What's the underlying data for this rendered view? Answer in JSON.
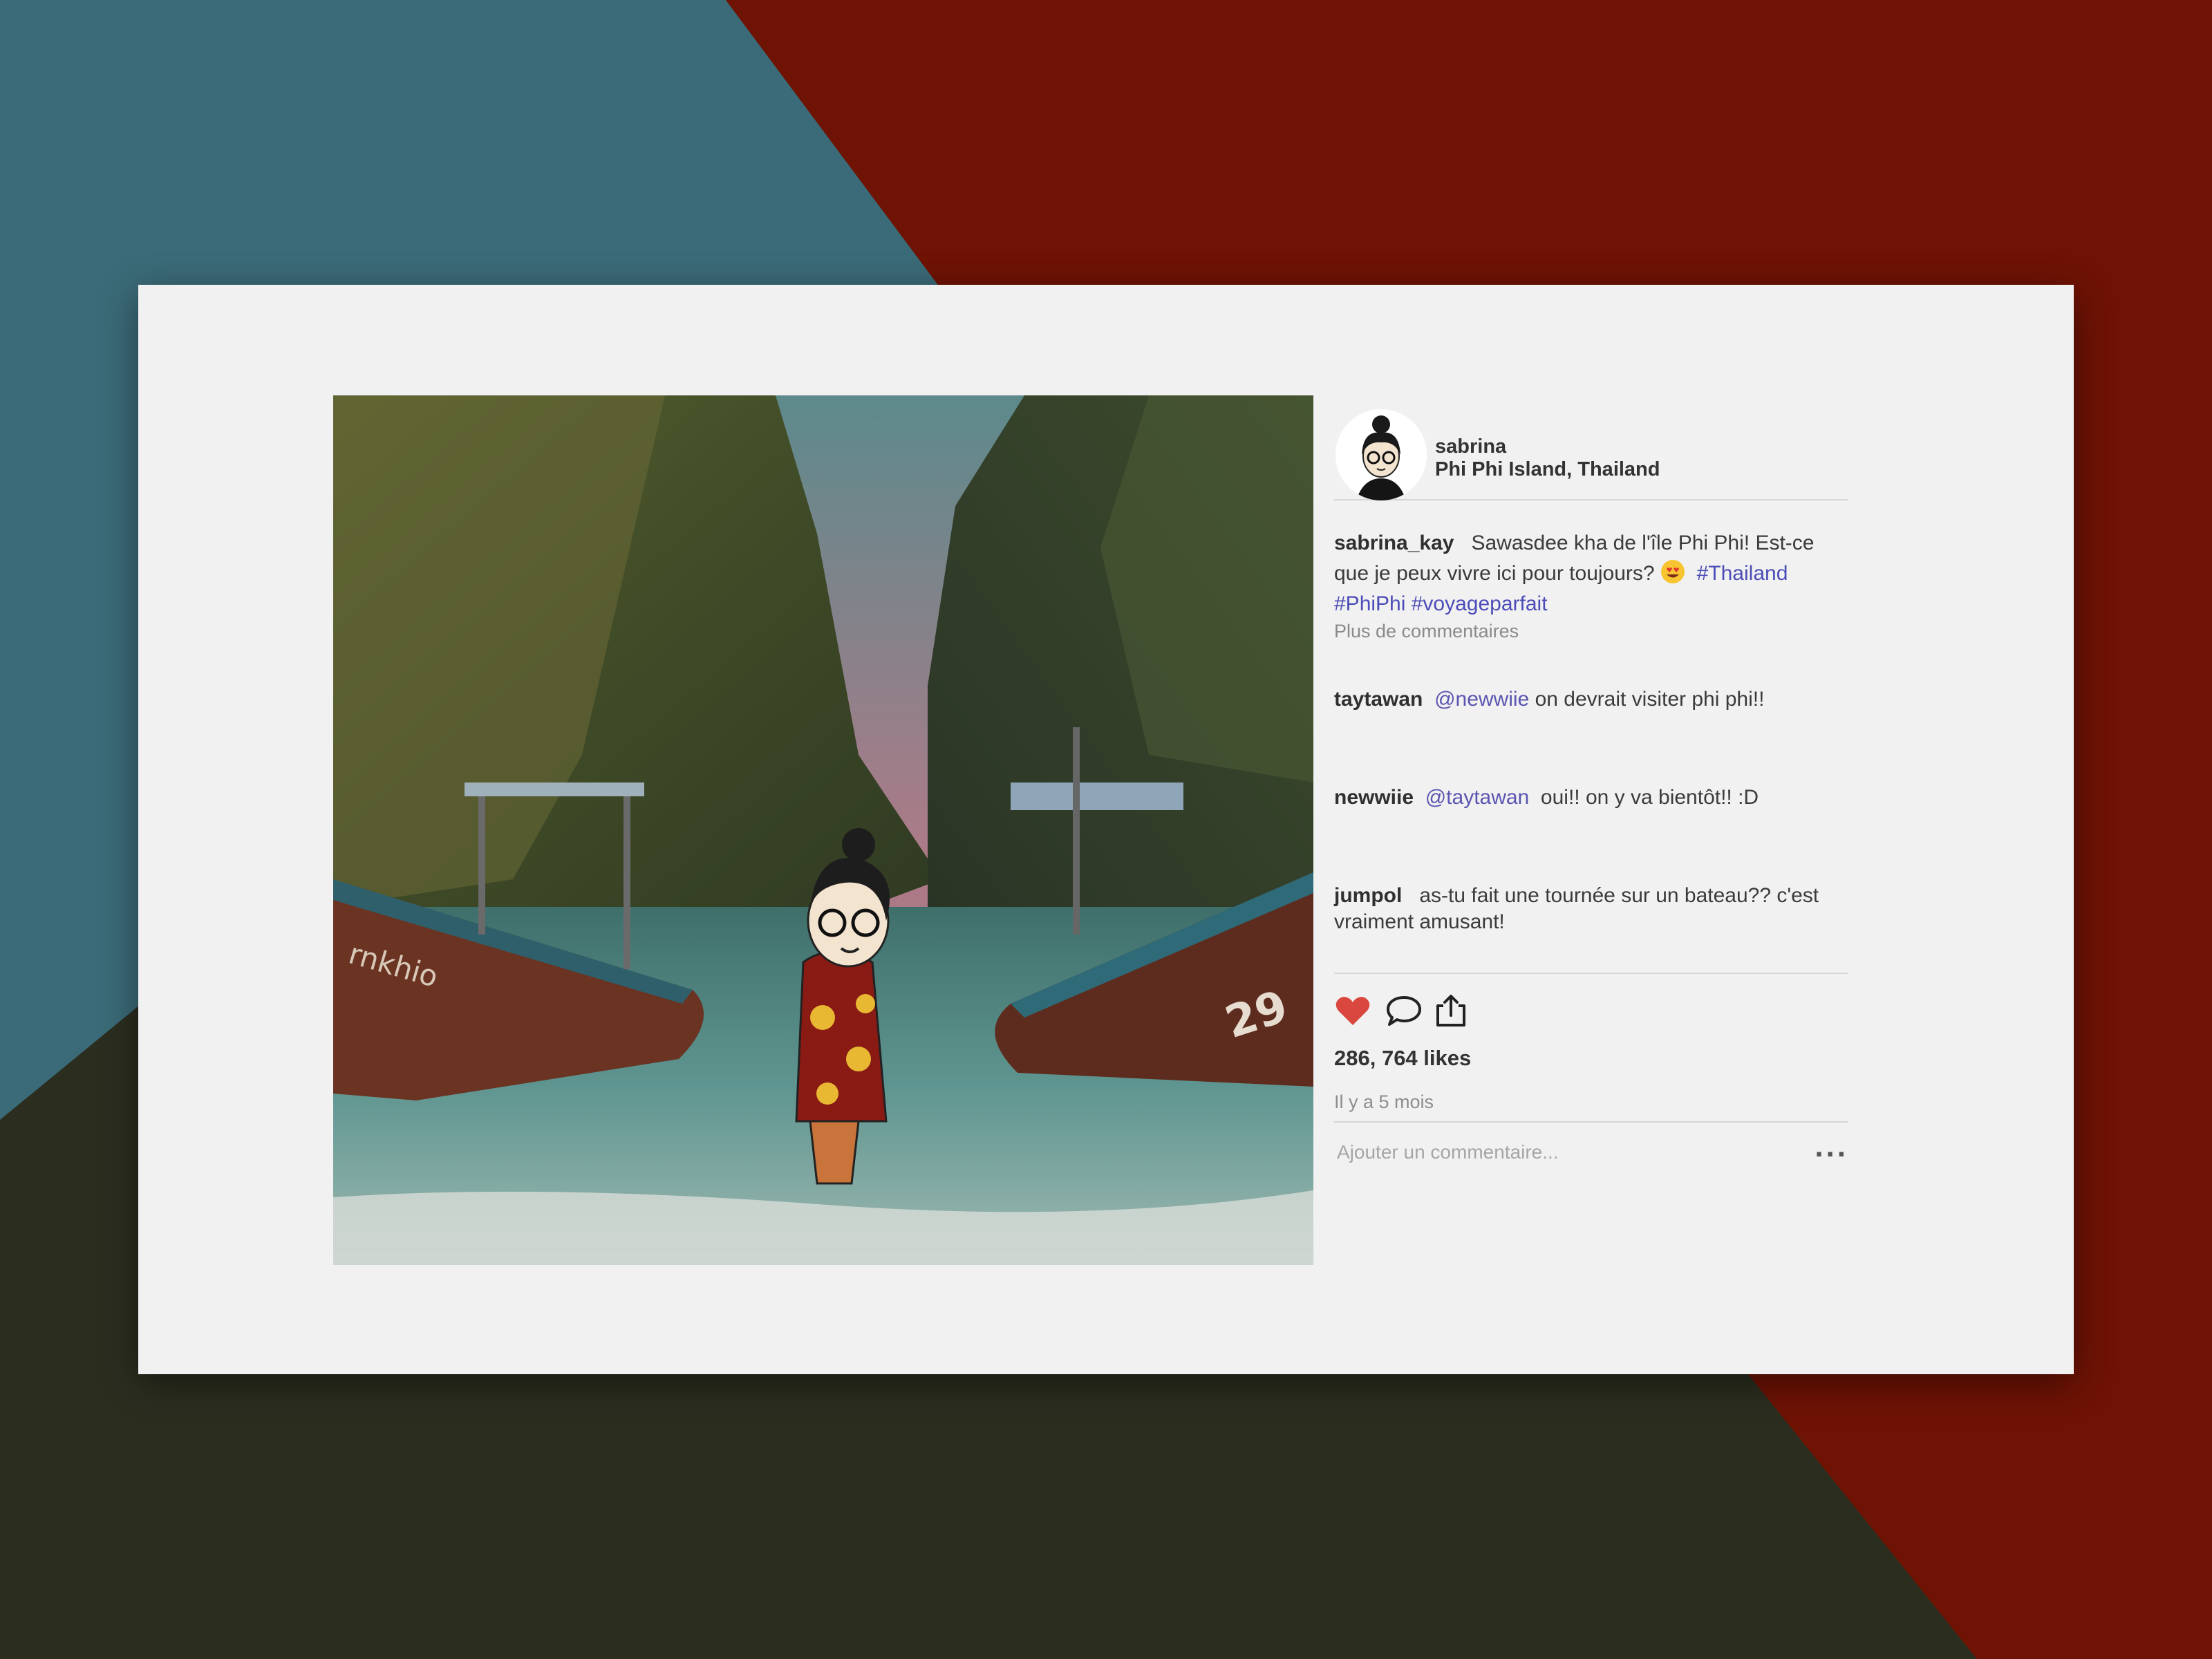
{
  "colors": {
    "bg_teal": "#3b6b78",
    "bg_red": "#6f1304",
    "bg_dark": "#2b2e1f",
    "card": "#f1f1f1",
    "link": "#4c4cb8",
    "heart": "#d9473f"
  },
  "post": {
    "author": "sabrina",
    "location": "Phi Phi Island, Thailand",
    "caption": {
      "username": "sabrina_kay",
      "text": "Sawasdee kha de l'île Phi Phi! Est-ce que je peux vivre ici pour toujours?",
      "emoji_icon": "heart-eyes-emoji-icon",
      "hashtags": [
        "#Thailand",
        "#PhiPhi",
        "#voyageparfait"
      ]
    },
    "more_comments": "Plus de commentaires",
    "comments": [
      {
        "username": "taytawan",
        "mention": "@newwiie",
        "text": "on devrait visiter phi phi!!"
      },
      {
        "username": "newwiie",
        "mention": "@taytawan",
        "text": "oui!! on y va bientôt!! :D"
      },
      {
        "username": "jumpol",
        "mention": "",
        "text": "as-tu fait une tournée sur un bateau?? c'est vraiment amusant!"
      }
    ],
    "actions": {
      "like_icon": "heart-icon",
      "comment_icon": "speech-bubble-icon",
      "share_icon": "share-icon"
    },
    "likes": "286, 764 likes",
    "time_ago": "Il y a 5 mois",
    "add_comment_placeholder": "Ajouter un commentaire...",
    "more_options": "..."
  }
}
